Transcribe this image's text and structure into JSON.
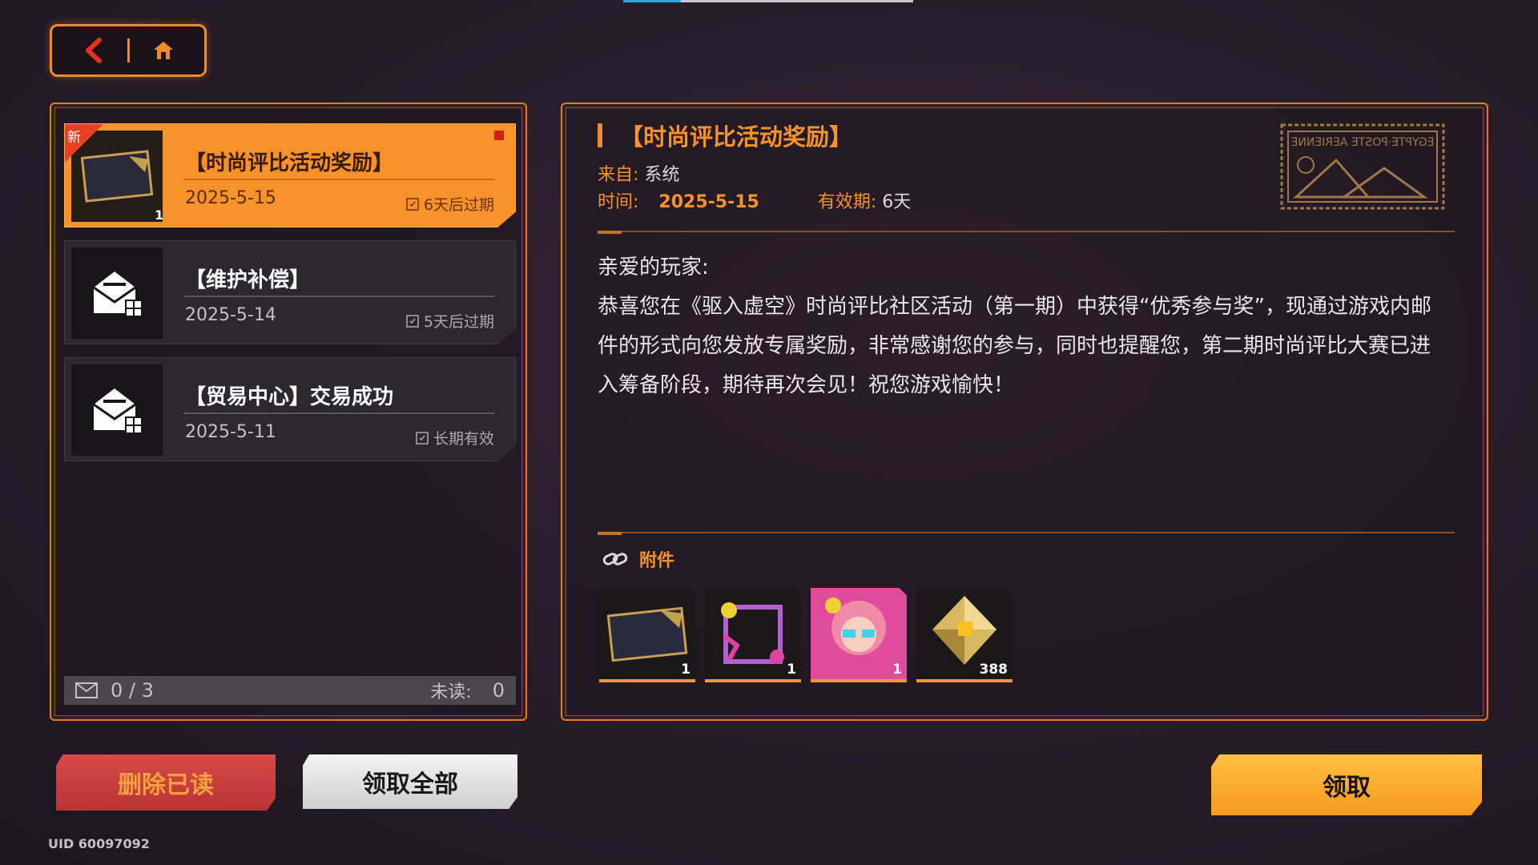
{
  "nav": {
    "back_icon": "chevron-left-icon",
    "home_icon": "home-icon"
  },
  "mails": [
    {
      "title": "【时尚评比活动奖励】",
      "date": "2025-5-15",
      "expire": "6天后过期",
      "new_tag": "新",
      "count": "1",
      "active": true
    },
    {
      "title": "【维护补偿】",
      "date": "2025-5-14",
      "expire": "5天后过期"
    },
    {
      "title": "【贸易中心】交易成功",
      "date": "2025-5-11",
      "expire": "长期有效"
    }
  ],
  "status": {
    "count": "0 / 3",
    "unread_label": "未读:",
    "unread_value": "0"
  },
  "detail": {
    "title": "【时尚评比活动奖励】",
    "from_label": "来自:",
    "from_value": "系统",
    "time_label": "时间:",
    "time_value": "2025-5-15",
    "valid_label": "有效期:",
    "valid_value": "6天",
    "greeting": "亲爱的玩家:",
    "body": "恭喜您在《驱入虚空》时尚评比社区活动（第一期）中获得“优秀参与奖”，现通过游戏内邮件的形式向您发放专属奖励，非常感谢您的参与，同时也提醒您，第二期时尚评比大赛已进入筹备阶段，期待再次会见！祝您游戏愉快！",
    "attach_label": "附件",
    "stamp_text": "EGYPTE·POSTE AERIENNE"
  },
  "attachments": [
    {
      "name": "card-frame",
      "count": "1"
    },
    {
      "name": "paint-frame",
      "count": "1"
    },
    {
      "name": "avatar-pink",
      "count": "1"
    },
    {
      "name": "gold-crystal",
      "count": "388"
    }
  ],
  "buttons": {
    "delete_read": "删除已读",
    "claim_all": "领取全部",
    "claim": "领取"
  },
  "uid": "UID 60097092",
  "colors": {
    "accent": "#f7922a",
    "delete": "#c83c3c",
    "claim": "#ffb030"
  }
}
